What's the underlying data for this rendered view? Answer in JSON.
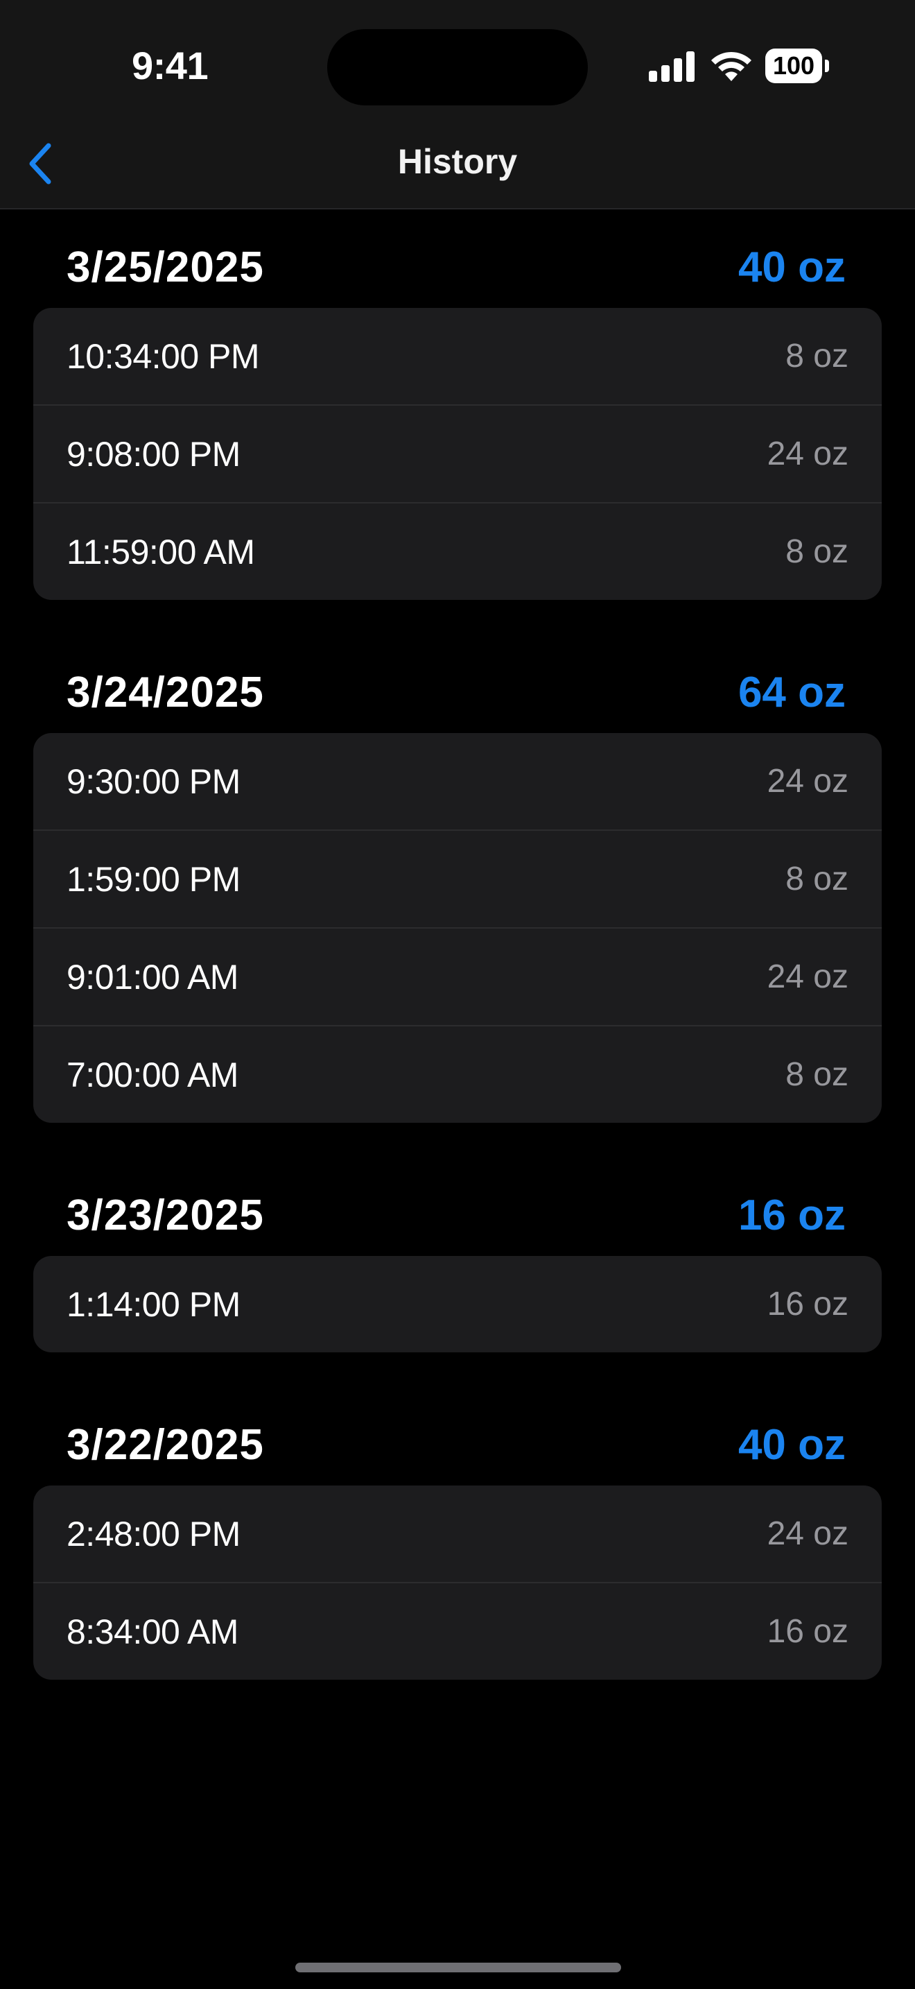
{
  "status_bar": {
    "time": "9:41",
    "battery": "100"
  },
  "nav": {
    "title": "History",
    "back_icon": "chevron-left-icon"
  },
  "colors": {
    "accent": "#1b84f0",
    "background": "#000000",
    "card": "#1c1c1e",
    "secondary_text": "#98989d"
  },
  "sections": [
    {
      "date": "3/25/2025",
      "total": "40 oz",
      "entries": [
        {
          "time": "10:34:00 PM",
          "amount": "8 oz"
        },
        {
          "time": "9:08:00 PM",
          "amount": "24 oz"
        },
        {
          "time": "11:59:00 AM",
          "amount": "8 oz"
        }
      ]
    },
    {
      "date": "3/24/2025",
      "total": "64 oz",
      "entries": [
        {
          "time": "9:30:00 PM",
          "amount": "24 oz"
        },
        {
          "time": "1:59:00 PM",
          "amount": "8 oz"
        },
        {
          "time": "9:01:00 AM",
          "amount": "24 oz"
        },
        {
          "time": "7:00:00 AM",
          "amount": "8 oz"
        }
      ]
    },
    {
      "date": "3/23/2025",
      "total": "16 oz",
      "entries": [
        {
          "time": "1:14:00 PM",
          "amount": "16 oz"
        }
      ]
    },
    {
      "date": "3/22/2025",
      "total": "40 oz",
      "entries": [
        {
          "time": "2:48:00 PM",
          "amount": "24 oz"
        },
        {
          "time": "8:34:00 AM",
          "amount": "16 oz"
        }
      ]
    }
  ]
}
